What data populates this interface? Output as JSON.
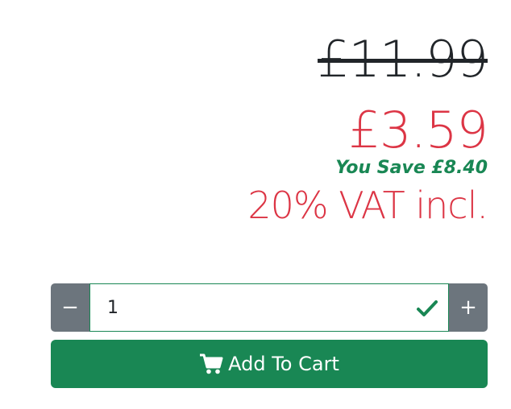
{
  "pricing": {
    "old_price": "£11.99",
    "new_price": "£3.59",
    "you_save": "You Save £8.40",
    "vat": "20% VAT incl."
  },
  "quantity": {
    "decrement_label": "−",
    "increment_label": "+",
    "value": "1",
    "valid_icon": "check-icon"
  },
  "cart": {
    "button_label": "Add To Cart",
    "icon": "cart-icon"
  },
  "colors": {
    "sale_red": "#dc3545",
    "success_green": "#198754",
    "secondary_gray": "#6c757d",
    "text_dark": "#212529"
  }
}
